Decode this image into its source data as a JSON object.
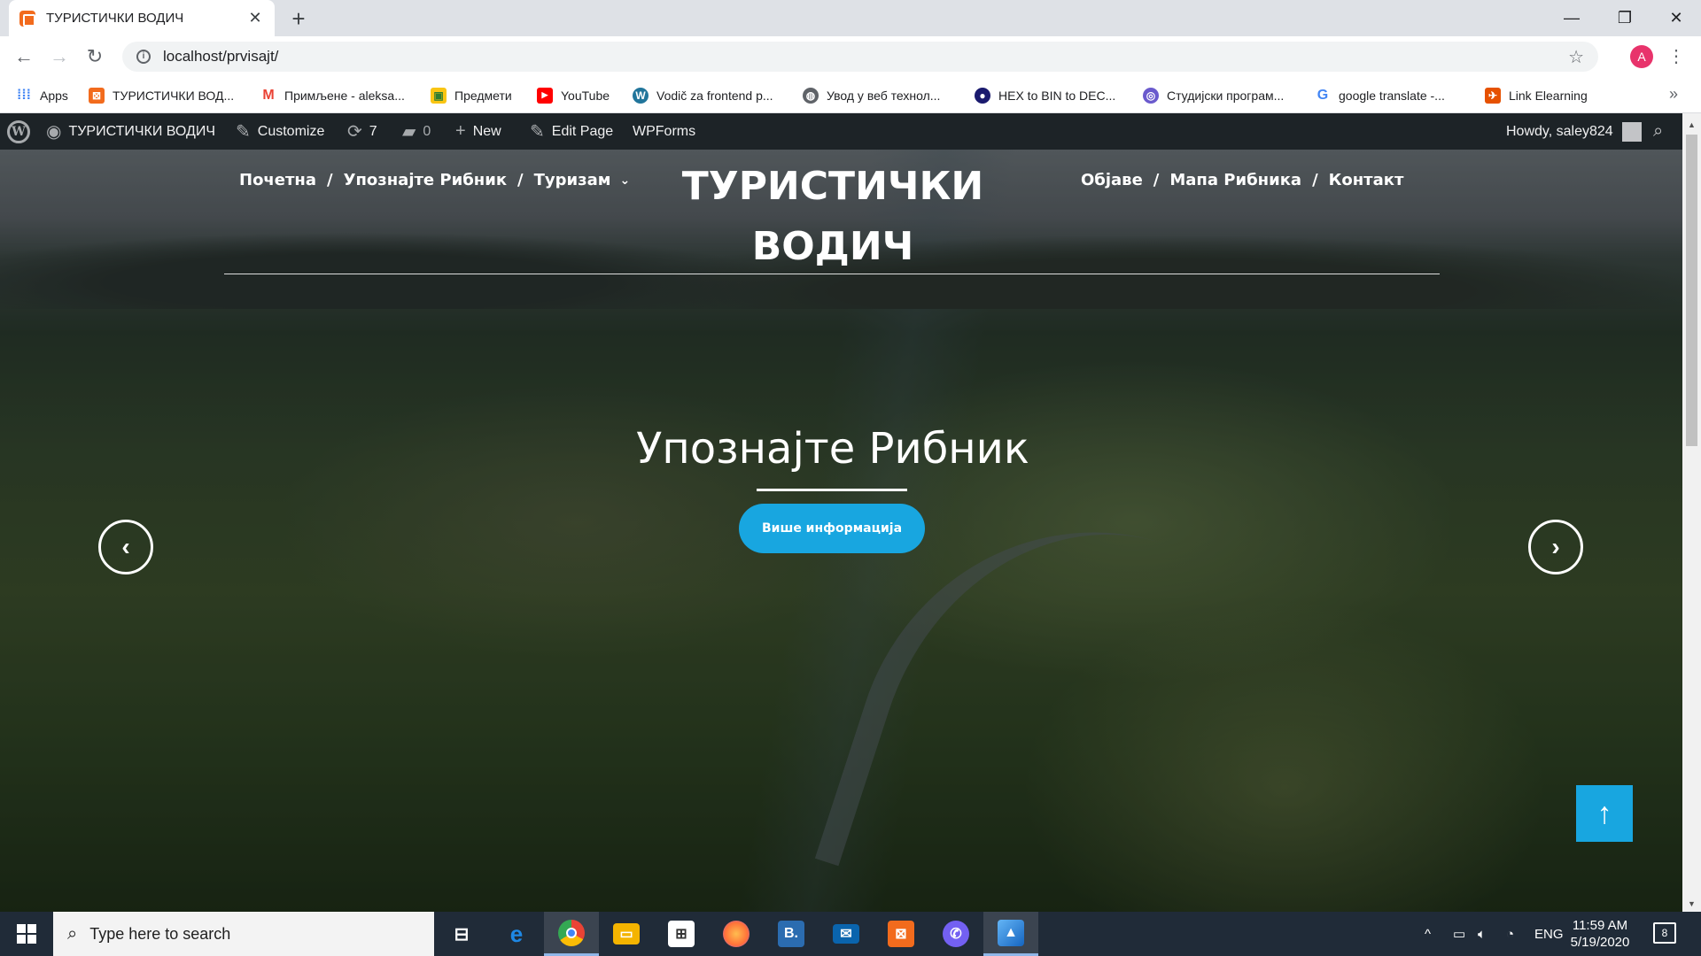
{
  "browser": {
    "tab_title": "ТУРИСТИЧКИ ВОДИЧ",
    "url": "localhost/prvisajt/",
    "profile_initial": "A",
    "bookmarks": [
      {
        "label": "Apps",
        "icon": "apps-grid-icon",
        "color": "#4285f4"
      },
      {
        "label": "ТУРИСТИЧКИ ВОД...",
        "icon": "xampp-icon",
        "color": "#f26b1d"
      },
      {
        "label": "Примљене - aleksa...",
        "icon": "gmail-icon",
        "color": "#ea4335"
      },
      {
        "label": "Предмети",
        "icon": "moodle-icon",
        "color": "#f9c513"
      },
      {
        "label": "YouTube",
        "icon": "youtube-icon",
        "color": "#ff0000"
      },
      {
        "label": "Vodič za frontend p...",
        "icon": "wordpress-icon",
        "color": "#21759b"
      },
      {
        "label": "Увод у веб технол...",
        "icon": "globe-icon",
        "color": "#5f6368"
      },
      {
        "label": "HEX to BIN to DEC...",
        "icon": "hex-icon",
        "color": "#1a1a6e"
      },
      {
        "label": "Студијски програм...",
        "icon": "university-icon",
        "color": "#6a5acd"
      },
      {
        "label": "google translate -...",
        "icon": "google-icon",
        "color": "#4285f4"
      },
      {
        "label": "Link Elearning",
        "icon": "elearning-icon",
        "color": "#e65100"
      }
    ]
  },
  "adminbar": {
    "site_name": "ТУРИСТИЧКИ ВОДИЧ",
    "customize": "Customize",
    "updates": "7",
    "comments": "0",
    "new": "New",
    "edit_page": "Edit Page",
    "wpforms": "WPForms",
    "howdy": "Howdy, saley824"
  },
  "site": {
    "title_line1": "ТУРИСТИЧКИ",
    "title_line2": "ВОДИЧ",
    "nav_left": [
      "Почетна",
      "Упознајте Рибник",
      "Туризам"
    ],
    "nav_right": [
      "Објаве",
      "Мапа Рибника",
      "Контакт"
    ],
    "separator": "/",
    "slide_title": "Упознајте Рибник",
    "slide_button": "Више информација"
  },
  "taskbar": {
    "search_placeholder": "Type here to search",
    "language": "ENG",
    "time": "11:59 AM",
    "date": "5/19/2020",
    "notifications": "8",
    "apps": [
      {
        "icon": "task-view-icon",
        "color": "#202b38"
      },
      {
        "icon": "edge-icon",
        "color": "#1e88e5"
      },
      {
        "icon": "chrome-icon",
        "color": "#34a853"
      },
      {
        "icon": "file-explorer-icon",
        "color": "#f4b400"
      },
      {
        "icon": "store-icon",
        "color": "#3c3c3c"
      },
      {
        "icon": "firefox-icon",
        "color": "#ff7139"
      },
      {
        "icon": "bootstrap-studio-icon",
        "color": "#2b6cb0"
      },
      {
        "icon": "mail-icon",
        "color": "#0a64ad"
      },
      {
        "icon": "xampp-icon",
        "color": "#f26b1d"
      },
      {
        "icon": "viber-icon",
        "color": "#7360f2"
      },
      {
        "icon": "photos-icon",
        "color": "#1976d2"
      }
    ]
  }
}
